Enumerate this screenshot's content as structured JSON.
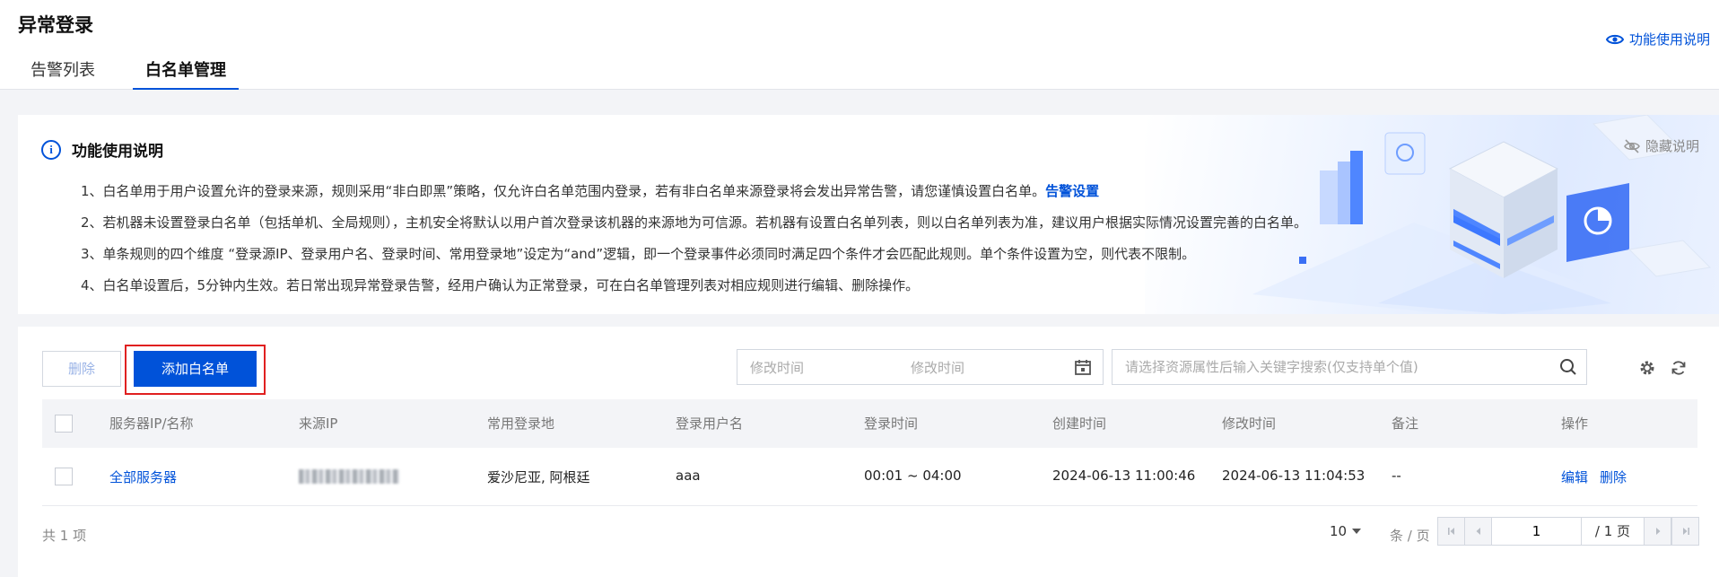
{
  "header": {
    "title": "异常登录",
    "help_link": "功能使用说明",
    "tabs": [
      {
        "label": "告警列表",
        "active": false
      },
      {
        "label": "白名单管理",
        "active": true
      }
    ]
  },
  "notice": {
    "title": "功能使用说明",
    "hide_label": "隐藏说明",
    "items": [
      {
        "text": "1、白名单用于用户设置允许的登录来源，规则采用“非白即黑”策略，仅允许白名单范围内登录，若有非白名单来源登录将会发出异常告警，请您谨慎设置白名单。",
        "link": "告警设置"
      },
      {
        "text": "2、若机器未设置登录白名单（包括单机、全局规则），主机安全将默认以用户首次登录该机器的来源地为可信源。若机器有设置白名单列表，则以白名单列表为准，建议用户根据实际情况设置完善的白名单。"
      },
      {
        "text": "3、单条规则的四个维度 “登录源IP、登录用户名、登录时间、常用登录地”设定为“and”逻辑，即一个登录事件必须同时满足四个条件才会匹配此规则。单个条件设置为空，则代表不限制。"
      },
      {
        "text": "4、白名单设置后，5分钟内生效。若日常出现异常登录告警，经用户确认为正常登录，可在白名单管理列表对相应规则进行编辑、删除操作。"
      }
    ]
  },
  "toolbar": {
    "delete_label": "删除",
    "add_label": "添加白名单",
    "date_start_placeholder": "修改时间",
    "date_end_placeholder": "修改时间",
    "search_placeholder": "请选择资源属性后输入关键字搜索(仅支持单个值)"
  },
  "table": {
    "columns": [
      "服务器IP/名称",
      "来源IP",
      "常用登录地",
      "登录用户名",
      "登录时间",
      "创建时间",
      "修改时间",
      "备注",
      "操作"
    ],
    "rows": [
      {
        "server": "全部服务器",
        "source_ip": "",
        "location": "爱沙尼亚, 阿根廷",
        "username": "aaa",
        "login_time": "00:01 ~ 04:00",
        "created": "2024-06-13 11:00:46",
        "modified": "2024-06-13 11:04:53",
        "remark": "--",
        "actions": {
          "edit": "编辑",
          "delete": "删除"
        }
      }
    ]
  },
  "footer": {
    "total": "共 1 项",
    "page_size": "10",
    "page_size_unit": "条 / 页",
    "current_page": "1",
    "total_pages": "/ 1 页"
  },
  "colors": {
    "primary": "#0052d9",
    "highlight": "#e02020"
  },
  "icons": [
    "eye-icon",
    "info-icon",
    "eye-off-icon",
    "calendar-icon",
    "search-icon",
    "gear-icon",
    "refresh-icon",
    "caret-down-icon",
    "first-page-icon",
    "prev-page-icon",
    "next-page-icon",
    "last-page-icon"
  ]
}
